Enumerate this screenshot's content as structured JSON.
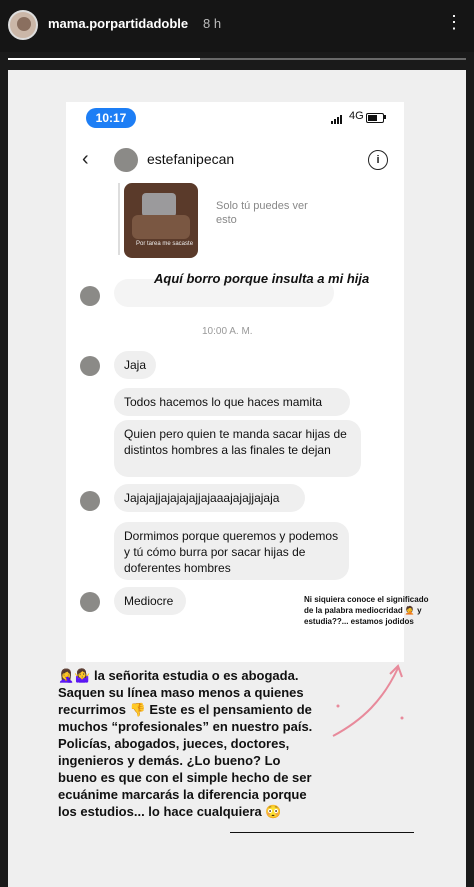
{
  "story": {
    "username": "mama.porpartidadoble",
    "timestamp": "8 h",
    "more": "⋮",
    "progress": 0.42
  },
  "screenshot": {
    "status_time": "10:17",
    "network": "4G",
    "chat_name": "estefanipecan",
    "info": "i",
    "media_label": "Por tarea me sacaste",
    "only_you": "Solo tú puedes ver esto",
    "redaction_note": "Aquí borro porque insulta a mi hija",
    "day_time": "10:00 A. M.",
    "messages": [
      "Jaja",
      "Todos hacemos lo que haces mamita",
      "Quien pero quien te manda sacar hijas de distintos hombres a las finales te dejan",
      "Jajajajjajajajajjajaaajajajjajaja",
      "Dormimos porque queremos y podemos y tú cómo burra por sacar hijas de doferentes hombres",
      "Mediocre"
    ]
  },
  "handwritten": "Ni siquiera conoce el significado de la palabra mediocridad 🤦 y estudia??... estamos jodidos",
  "caption": "🤦‍♀️🤷‍♀️ la señorita estudia o es abogada. Saquen su línea maso menos a quienes recurrimos 👎 Este es el pensamiento de muchos “profesionales” en nuestro país. Policías, abogados, jueces, doctores, ingenieros y demás. ¿Lo bueno? Lo bueno es que con el simple hecho de ser ecuánime marcarás la diferencia porque los estudios... lo hace cualquiera 😳"
}
